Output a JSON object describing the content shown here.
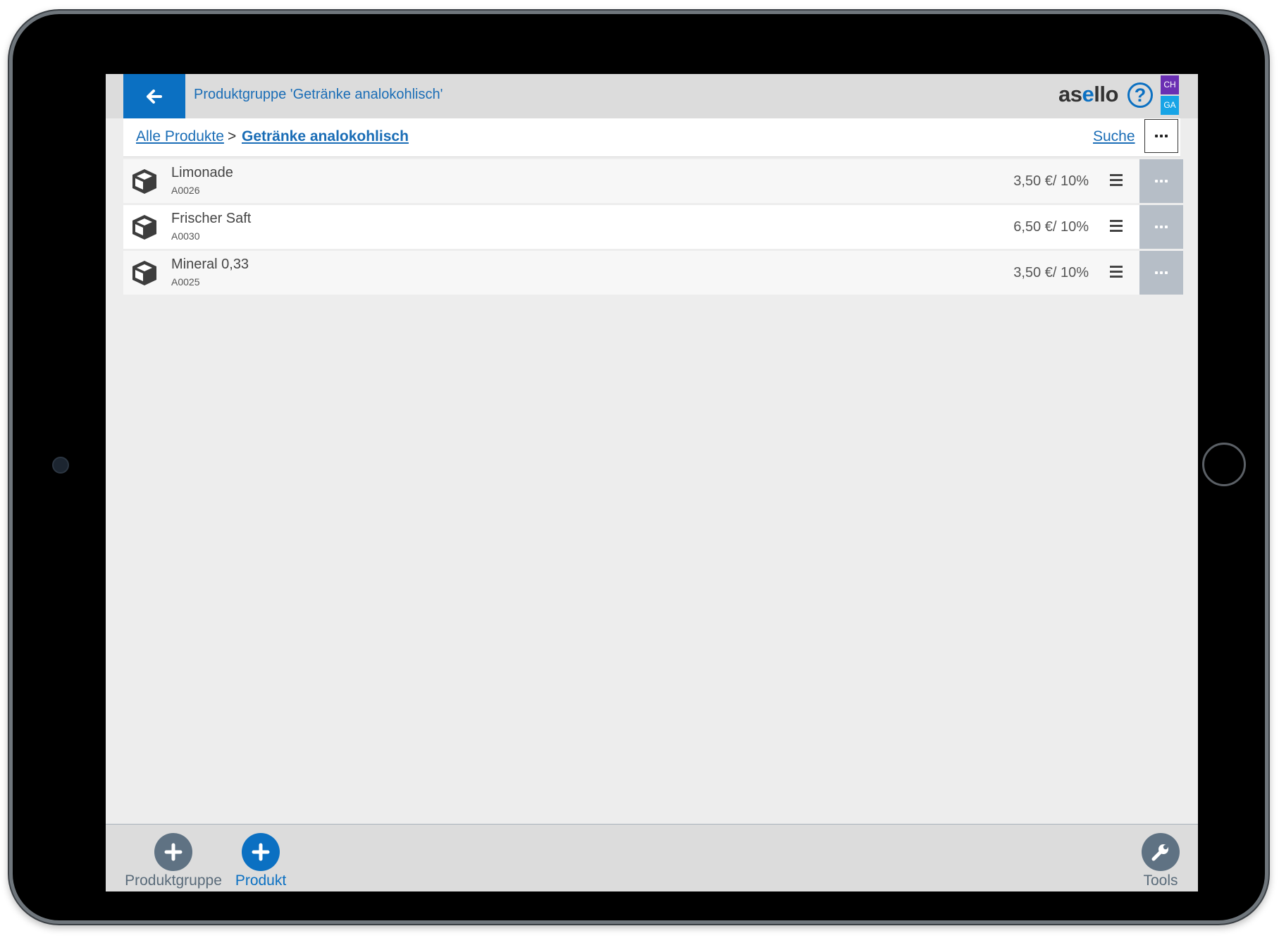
{
  "header": {
    "title": "Produktgruppe 'Getränke analokohlisch'",
    "logo": {
      "prefix": "as",
      "accent": "e",
      "suffix": "llo"
    },
    "help_label": "?",
    "badges": [
      "CH",
      "GA"
    ],
    "colors": {
      "accent": "#0b70c2",
      "badge_ch": "#6a2fb3",
      "badge_ga": "#17a4e6"
    }
  },
  "breadcrumb": {
    "root": "Alle Produkte",
    "separator": ">",
    "current": "Getränke analokohlisch",
    "search": "Suche"
  },
  "products": [
    {
      "name": "Limonade",
      "code": "A0026",
      "price": "3,50 €/ 10%"
    },
    {
      "name": "Frischer Saft",
      "code": "A0030",
      "price": "6,50 €/ 10%"
    },
    {
      "name": "Mineral 0,33",
      "code": "A0025",
      "price": "3,50 €/ 10%"
    }
  ],
  "footer": {
    "add_group_label": "Produktgruppe",
    "add_product_label": "Produkt",
    "tools_label": "Tools"
  }
}
